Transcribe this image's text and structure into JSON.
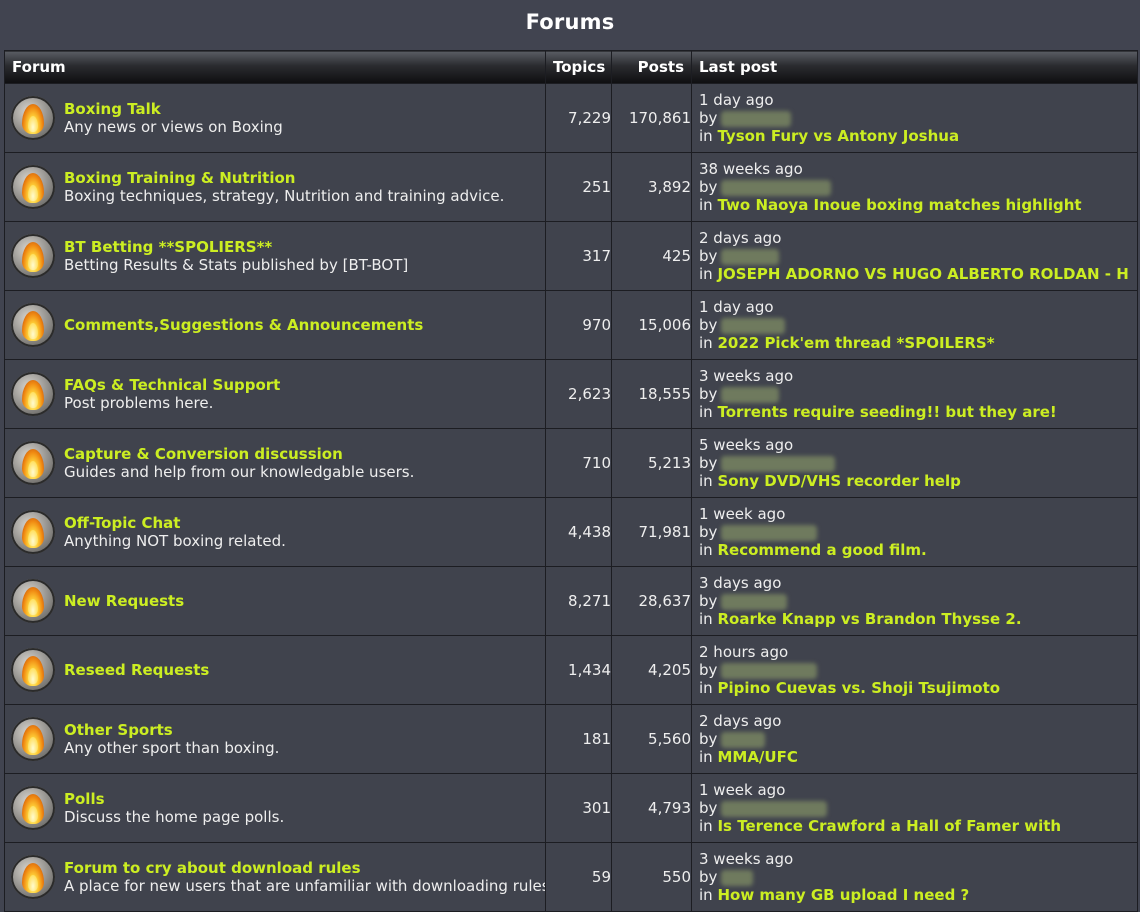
{
  "page": {
    "title": "Forums"
  },
  "columns": {
    "forum": "Forum",
    "topics": "Topics",
    "posts": "Posts",
    "last_post": "Last post"
  },
  "labels": {
    "by": "by",
    "in": "in"
  },
  "rows": [
    {
      "name": "Boxing Talk",
      "desc": "Any news or views on Boxing",
      "topics": "7,229",
      "posts": "170,861",
      "time": "1 day ago",
      "topic": "Tyson Fury vs Antony Joshua"
    },
    {
      "name": "Boxing Training & Nutrition",
      "desc": "Boxing techniques, strategy, Nutrition and training advice.",
      "topics": "251",
      "posts": "3,892",
      "time": "38 weeks ago",
      "topic": "Two Naoya Inoue boxing matches highlight"
    },
    {
      "name": "BT Betting **SPOLIERS**",
      "desc": "Betting Results & Stats published by [BT-BOT]",
      "topics": "317",
      "posts": "425",
      "time": "2 days ago",
      "topic": "JOSEPH ADORNO VS HUGO ALBERTO ROLDAN - H"
    },
    {
      "name": "Comments,Suggestions & Announcements",
      "desc": "",
      "topics": "970",
      "posts": "15,006",
      "time": "1 day ago",
      "topic": "2022 Pick'em thread *SPOILERS*"
    },
    {
      "name": "FAQs & Technical Support",
      "desc": "Post problems here.",
      "topics": "2,623",
      "posts": "18,555",
      "time": "3 weeks ago",
      "topic": "Torrents require seeding!! but they are!"
    },
    {
      "name": "Capture & Conversion discussion",
      "desc": "Guides and help from our knowledgable users.",
      "topics": "710",
      "posts": "5,213",
      "time": "5 weeks ago",
      "topic": "Sony DVD/VHS recorder help"
    },
    {
      "name": "Off-Topic Chat",
      "desc": "Anything NOT boxing related.",
      "topics": "4,438",
      "posts": "71,981",
      "time": "1 week ago",
      "topic": "Recommend a good film."
    },
    {
      "name": "New Requests",
      "desc": "",
      "topics": "8,271",
      "posts": "28,637",
      "time": "3 days ago",
      "topic": "Roarke Knapp vs Brandon Thysse 2."
    },
    {
      "name": "Reseed Requests",
      "desc": "",
      "topics": "1,434",
      "posts": "4,205",
      "time": "2 hours ago",
      "topic": "Pipino Cuevas vs. Shoji Tsujimoto"
    },
    {
      "name": "Other Sports",
      "desc": "Any other sport than boxing.",
      "topics": "181",
      "posts": "5,560",
      "time": "2 days ago",
      "topic": "MMA/UFC"
    },
    {
      "name": "Polls",
      "desc": "Discuss the home page polls.",
      "topics": "301",
      "posts": "4,793",
      "time": "1 week ago",
      "topic": "Is Terence Crawford a Hall of Famer with"
    },
    {
      "name": "Forum to cry about download rules",
      "desc": "A place for new users that are unfamiliar with downloading rules",
      "topics": "59",
      "posts": "550",
      "time": "3 weeks ago",
      "topic": "How many GB upload I need ?"
    }
  ],
  "colors": {
    "background": "#414450",
    "link": "#ccee22",
    "text": "#eeeeee",
    "border": "#1c1d22",
    "header_text": "#ffffff"
  },
  "icons": {
    "forum_icon": "flame-icon"
  }
}
